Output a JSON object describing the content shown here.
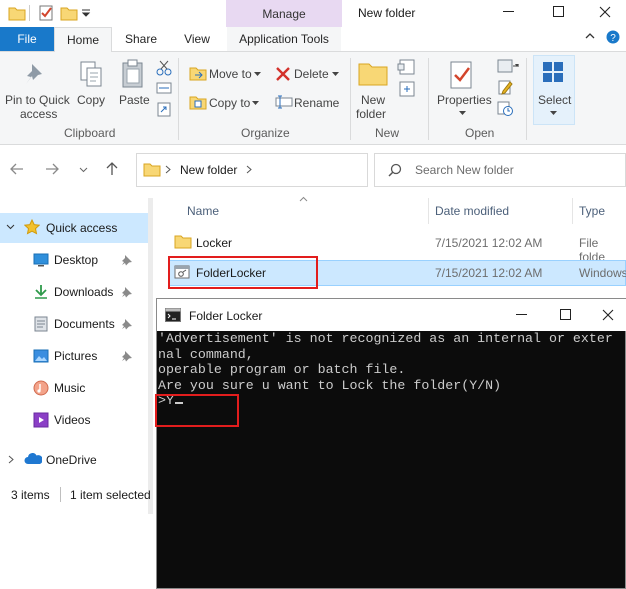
{
  "window": {
    "title": "New folder",
    "manage_tab": "Manage"
  },
  "ribbon": {
    "tabs": {
      "file": "File",
      "home": "Home",
      "share": "Share",
      "view": "View",
      "application_tools": "Application Tools"
    },
    "clipboard": {
      "pin_line1": "Pin to Quick",
      "pin_line2": "access",
      "copy": "Copy",
      "paste": "Paste",
      "group": "Clipboard"
    },
    "organize": {
      "move_to": "Move to",
      "copy_to": "Copy to",
      "delete": "Delete",
      "rename": "Rename",
      "group": "Organize"
    },
    "new": {
      "new_folder_line1": "New",
      "new_folder_line2": "folder",
      "group": "New"
    },
    "open": {
      "properties": "Properties",
      "group": "Open"
    },
    "select": {
      "label": "Select"
    }
  },
  "address": {
    "crumb": "New folder",
    "search_placeholder": "Search New folder"
  },
  "nav": {
    "items": [
      {
        "label": "Quick access"
      },
      {
        "label": "Desktop"
      },
      {
        "label": "Downloads"
      },
      {
        "label": "Documents"
      },
      {
        "label": "Pictures"
      },
      {
        "label": "Music"
      },
      {
        "label": "Videos"
      },
      {
        "label": "OneDrive"
      }
    ]
  },
  "files": {
    "headers": {
      "name": "Name",
      "date": "Date modified",
      "type": "Type"
    },
    "rows": [
      {
        "name": "Locker",
        "date": "7/15/2021 12:02 AM",
        "type": "File folde"
      },
      {
        "name": "FolderLocker",
        "date": "7/15/2021 12:02 AM",
        "type": "Windows"
      }
    ]
  },
  "status": {
    "count": "3 items",
    "selected": "1 item selected"
  },
  "console": {
    "title": "Folder Locker",
    "lines": [
      "'Advertisement' is not recognized as an internal or exter",
      "nal command,",
      "operable program or batch file.",
      "Are you sure u want to Lock the folder(Y/N)",
      ">Y"
    ]
  },
  "colors": {
    "accent": "#1979ca",
    "manage": "#e8d9f2",
    "selection": "#cce8ff",
    "highlight": "#e21d1d"
  }
}
